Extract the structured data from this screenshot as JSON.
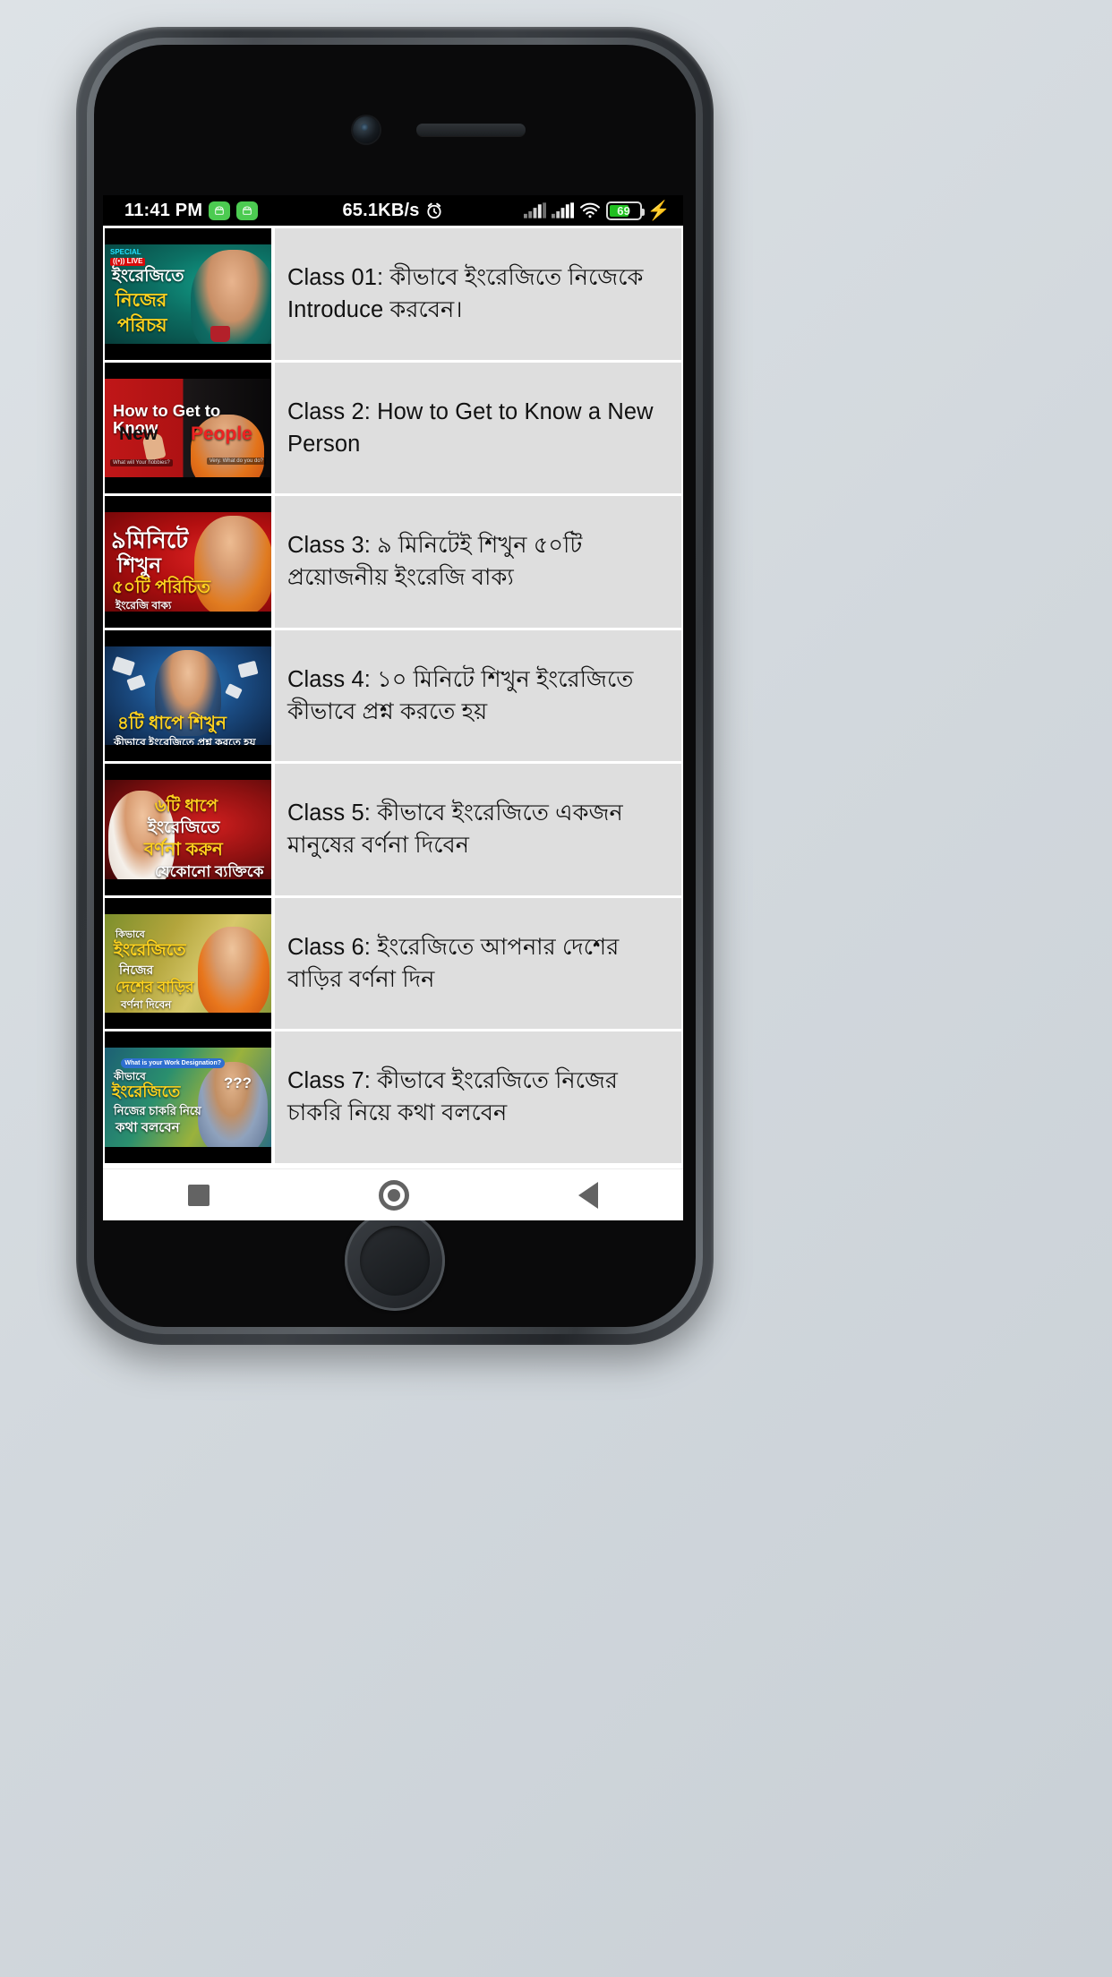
{
  "status_bar": {
    "time": "11:41 PM",
    "notification_icons": [
      "android-notification-icon",
      "android-notification-icon"
    ],
    "network_speed": "65.1KB/s",
    "alarm_icon": "alarm-clock-icon",
    "signal_1_icon": "cellular-signal-icon",
    "signal_2_icon": "cellular-signal-icon",
    "wifi_icon": "wifi-icon",
    "battery_percent": "69",
    "battery_fill_color": "#20c020",
    "charging_icon": "lightning-bolt-icon"
  },
  "list": {
    "items": [
      {
        "title": " Class 01: কীভাবে ইংরেজিতে নিজেকে Introduce করবেন।",
        "thumb": {
          "name": "class-01-thumbnail",
          "badge": "SPECIAL",
          "live": "((•)) LIVE",
          "line1": "ইংরেজিতে",
          "line2": "নিজের",
          "line3": "পরিচয়"
        }
      },
      {
        "title": " Class 2: How to Get to Know a New Person",
        "thumb": {
          "name": "class-02-thumbnail",
          "line1": "How to Get to Know",
          "line2a": "New",
          "line2b": "People",
          "caption_left": "What will Your hobbies?",
          "caption_right": "Very. What do you do?"
        }
      },
      {
        "title": "Class 3: ৯ মিনিটেই শিখুন ৫০টি প্রয়োজনীয় ইংরেজি বাক্য",
        "thumb": {
          "name": "class-03-thumbnail",
          "line1": "৯মিনিটে",
          "line2": "শিখুন",
          "line3": "৫০টি পরিচিত",
          "line4": "ইংরেজি বাক্য"
        }
      },
      {
        "title": "Class 4: ১০ মিনিটে শিখুন ইংরেজিতে কীভাবে প্রশ্ন করতে হয়",
        "thumb": {
          "name": "class-04-thumbnail",
          "line1": "৪টি ধাপে শিখুন",
          "line2": "কীভাবে ইংরেজিতে প্রশ্ন করতে হয়"
        }
      },
      {
        "title": "Class 5: কীভাবে ইংরেজিতে একজন মানুষের বর্ণনা দিবেন",
        "thumb": {
          "name": "class-05-thumbnail",
          "line1": "৬টি ধাপে",
          "line2": "ইংরেজিতে",
          "line3": "বর্ণনা করুন",
          "line4": "যেকোনো ব্যক্তিকে"
        }
      },
      {
        "title": "Class 6: ইংরেজিতে আপনার দেশের বাড়ির বর্ণনা দিন",
        "thumb": {
          "name": "class-06-thumbnail",
          "line1": "কিভাবে",
          "line2": "ইংরেজিতে",
          "line3": "নিজের",
          "line4": "দেশের বাড়ির",
          "line5": "বর্ণনা দিবেন"
        }
      },
      {
        "title": " Class 7: কীভাবে ইংরেজিতে নিজের চাকরি নিয়ে কথা বলবেন",
        "thumb": {
          "name": "class-07-thumbnail",
          "line1": "কীভাবে",
          "line2": "ইংরেজিতে",
          "line3": "নিজের চাকরি নিয়ে",
          "line4": "কথা বলবেন",
          "bubble": "What is your Work Designation?",
          "question_marks": "???"
        }
      }
    ]
  },
  "nav_bar": {
    "recent_apps": "recent-apps-icon",
    "home": "home-icon",
    "back": "back-icon"
  }
}
